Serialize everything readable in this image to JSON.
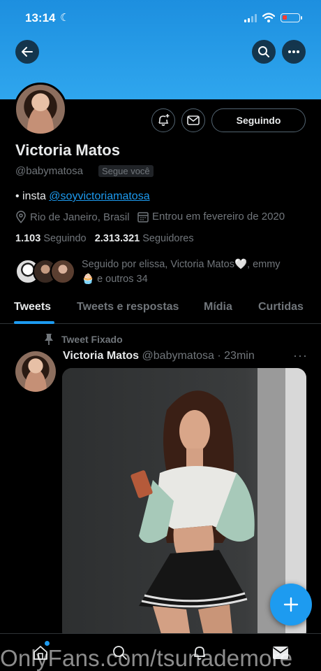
{
  "status_bar": {
    "time": "13:14"
  },
  "header": {
    "back_icon": "arrow-left-icon",
    "search_icon": "search-icon",
    "more_icon": "more-horizontal-icon",
    "banner_color": "#1d9bf0"
  },
  "profile": {
    "name": "Victoria Matos",
    "handle": "@babymatosa",
    "follows_you": "Segue você",
    "follow_button": "Seguindo",
    "bio_prefix": "• insta ",
    "bio_link": "@soyvictoriamatosa",
    "location": "Rio de Janeiro, Brasil",
    "joined": "Entrou em fevereiro de 2020",
    "following_count": "1.103",
    "following_label": "Seguindo",
    "followers_count": "2.313.321",
    "followers_label": "Seguidores",
    "followed_by_line1": "Seguido por elissa, Victoria Matos🤍, emmy",
    "followed_by_line2": "🧁 e outros 34"
  },
  "tabs": [
    "Tweets",
    "Tweets e respostas",
    "Mídia",
    "Curtidas"
  ],
  "tweet": {
    "pinned_label": "Tweet Fixado",
    "author": "Victoria Matos",
    "meta": "@babymatosa · 23min",
    "more": "···"
  },
  "bottom_nav": [
    "home-icon",
    "search-icon",
    "bell-icon",
    "mail-icon"
  ],
  "watermark": "OnlyFans.com/tsunademore",
  "accent_color": "#1d9bf0"
}
